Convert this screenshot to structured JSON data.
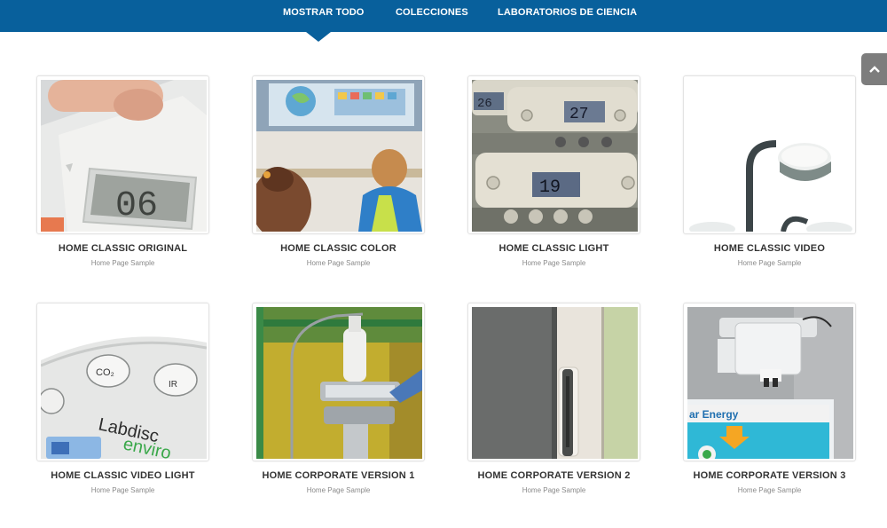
{
  "nav": {
    "tabs": [
      {
        "label": "MOSTRAR TODO",
        "active": true
      },
      {
        "label": "COLECCIONES",
        "active": false
      },
      {
        "label": "LABORATORIOS DE CIENCIA",
        "active": false
      }
    ],
    "bar_color": "#08609c"
  },
  "scroll_top": {
    "icon": "chevron-up-icon"
  },
  "gallery": {
    "items": [
      {
        "title": "HOME CLASSIC ORIGINAL",
        "subtitle": "Home Page Sample",
        "image": "handheld-meter-display-06",
        "display_text": "06"
      },
      {
        "title": "HOME CLASSIC COLOR",
        "subtitle": "Home Page Sample",
        "image": "children-in-classroom"
      },
      {
        "title": "HOME CLASSIC LIGHT",
        "subtitle": "Home Page Sample",
        "image": "stacked-meters-displays",
        "display_texts": [
          "26",
          "27",
          "19"
        ]
      },
      {
        "title": "HOME CLASSIC VIDEO",
        "subtitle": "Home Page Sample",
        "image": "document-camera"
      },
      {
        "title": "HOME CLASSIC VIDEO LIGHT",
        "subtitle": "Home Page Sample",
        "image": "labdisc-enviro-device",
        "device_texts": [
          "Labdisc",
          "enviro",
          "CO₂",
          "IR"
        ]
      },
      {
        "title": "HOME CORPORATE VERSION 1",
        "subtitle": "Home Page Sample",
        "image": "lab-sensor-on-clamp"
      },
      {
        "title": "HOME CORPORATE VERSION 2",
        "subtitle": "Home Page Sample",
        "image": "door-handle-closeup"
      },
      {
        "title": "HOME CORPORATE VERSION 3",
        "subtitle": "Home Page Sample",
        "image": "wall-mounted-projector",
        "board_text": "ar Energy"
      }
    ]
  }
}
